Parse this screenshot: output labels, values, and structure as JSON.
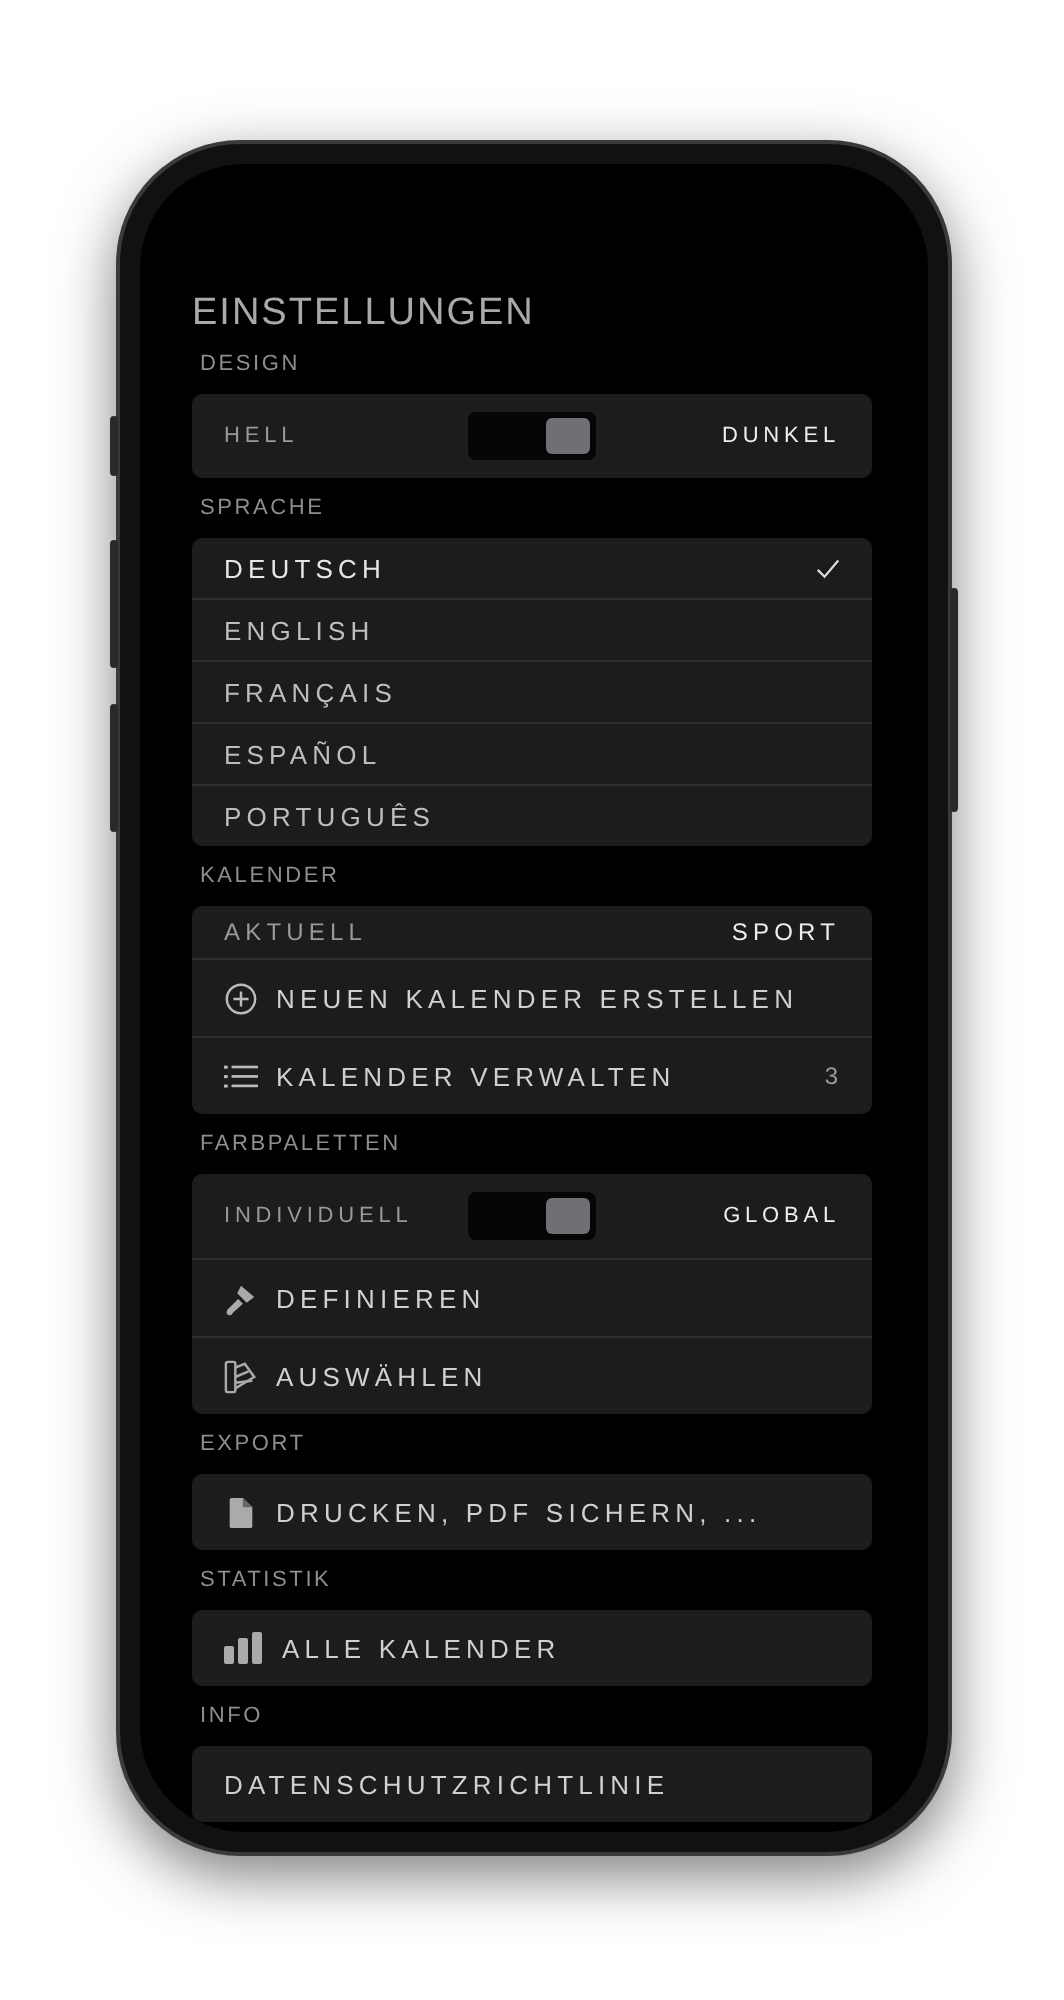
{
  "title": "EINSTELLUNGEN",
  "sections": [
    {
      "label": "DESIGN",
      "rows": [
        {
          "kind": "toggle",
          "left": "HELL",
          "right": "DUNKEL",
          "on": true
        }
      ]
    },
    {
      "label": "SPRACHE",
      "rows": [
        {
          "kind": "option",
          "label": "DEUTSCH",
          "selected": true
        },
        {
          "kind": "option",
          "label": "ENGLISH",
          "selected": false
        },
        {
          "kind": "option",
          "label": "FRANÇAIS",
          "selected": false
        },
        {
          "kind": "option",
          "label": "ESPAÑOL",
          "selected": false
        },
        {
          "kind": "option",
          "label": "PORTUGUÊS",
          "selected": false
        }
      ]
    },
    {
      "label": "KALENDER",
      "rows": [
        {
          "kind": "value",
          "label": "AKTUELL",
          "value": "SPORT"
        },
        {
          "kind": "create",
          "label": "NEUEN KALENDER ERSTELLEN"
        },
        {
          "kind": "manage",
          "label": "KALENDER VERWALTEN",
          "value": "3"
        }
      ]
    },
    {
      "label": "FARBPALETTEN",
      "rows": [
        {
          "kind": "toggle",
          "left": "INDIVIDUELL",
          "right": "GLOBAL",
          "on": true
        },
        {
          "kind": "define",
          "label": "DEFINIEREN"
        },
        {
          "kind": "choose",
          "label": "AUSWÄHLEN"
        }
      ]
    },
    {
      "label": "EXPORT",
      "rows": [
        {
          "kind": "export",
          "label": "DRUCKEN, PDF SICHERN, ..."
        }
      ]
    },
    {
      "label": "STATISTIK",
      "rows": [
        {
          "kind": "statistics",
          "label": "ALLE KALENDER"
        }
      ]
    },
    {
      "label": "INFO",
      "rows": [
        {
          "kind": "link",
          "label": "DATENSCHUTZRICHTLINIE"
        }
      ]
    }
  ]
}
